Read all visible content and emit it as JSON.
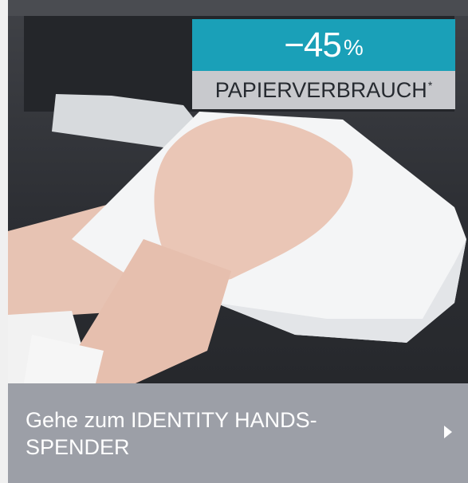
{
  "promo_badge": {
    "value": "−45",
    "unit": "%",
    "label": "PAPIERVERBRAUCH",
    "footnote_mark": "*"
  },
  "cta": {
    "label": "Gehe zum IDENTITY HANDS- SPENDER",
    "arrow_icon": "chevron-right-icon"
  },
  "colors": {
    "badge_accent": "#1aa0b8",
    "badge_label_bg": "#c8c9cd",
    "cta_bg": "#9c9fa7",
    "photo_bg": "#2f3035"
  }
}
